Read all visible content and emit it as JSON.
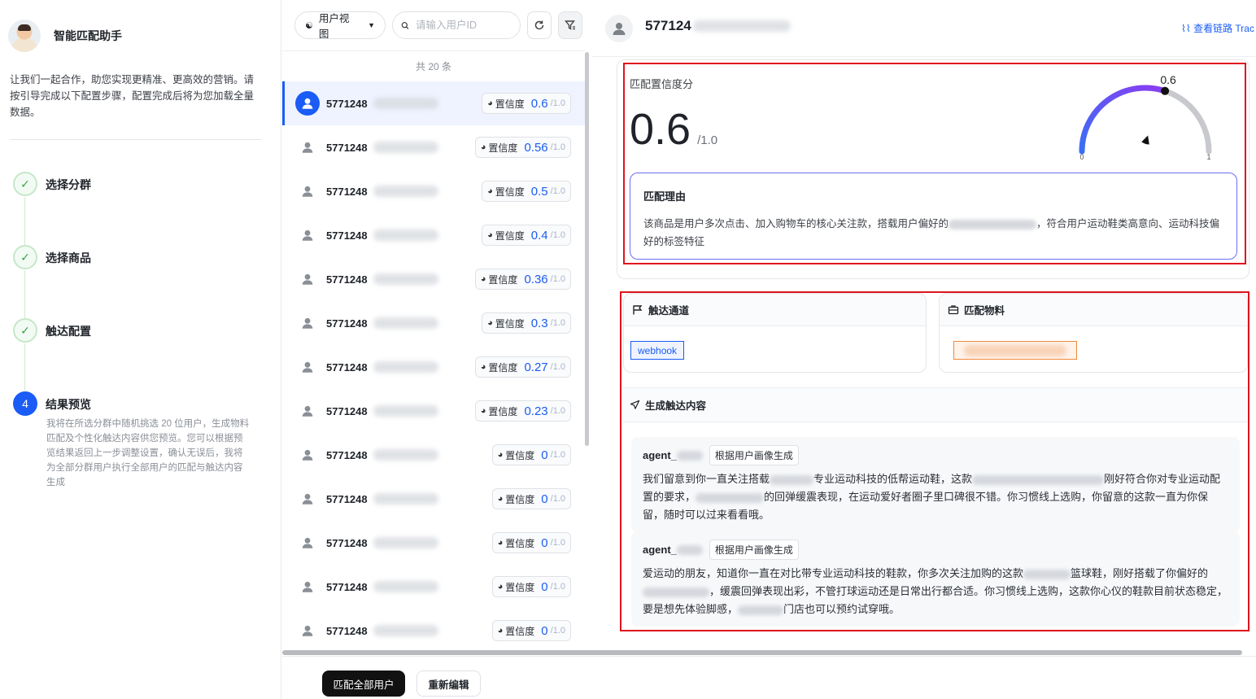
{
  "assistant": {
    "name": "智能匹配助手",
    "intro": "让我们一起合作，助您实现更精准、更高效的营销。请按引导完成以下配置步骤，配置完成后将为您加载全量数据。"
  },
  "steps": [
    {
      "index": "",
      "title": "选择分群",
      "status": "done"
    },
    {
      "index": "",
      "title": "选择商品",
      "status": "done"
    },
    {
      "index": "",
      "title": "触达配置",
      "status": "done"
    },
    {
      "index": "4",
      "title": "结果预览",
      "status": "active",
      "desc": "我将在所选分群中随机挑选 20 位用户，生成物料匹配及个性化触达内容供您预览。您可以根据预览结果返回上一步调整设置，确认无误后，我将为全部分群用户执行全部用户的匹配与触达内容生成"
    }
  ],
  "toolbar": {
    "view_label": "用户视图",
    "search_placeholder": "请输入用户ID"
  },
  "list": {
    "total_label": "共 20 条",
    "score_label": "置信度",
    "score_den": "/1.0",
    "rows": [
      {
        "id": "5771248",
        "score": "0.6"
      },
      {
        "id": "5771248",
        "score": "0.56"
      },
      {
        "id": "5771248",
        "score": "0.5"
      },
      {
        "id": "5771248",
        "score": "0.4"
      },
      {
        "id": "5771248",
        "score": "0.36"
      },
      {
        "id": "5771248",
        "score": "0.3"
      },
      {
        "id": "5771248",
        "score": "0.27"
      },
      {
        "id": "5771248",
        "score": "0.23"
      },
      {
        "id": "5771248",
        "score": "0"
      },
      {
        "id": "5771248",
        "score": "0"
      },
      {
        "id": "5771248",
        "score": "0"
      },
      {
        "id": "5771248",
        "score": "0"
      },
      {
        "id": "5771248",
        "score": "0"
      }
    ]
  },
  "detail": {
    "user_id": "577124",
    "trace_link": "查看链路 Trac",
    "score_title": "匹配置信度分",
    "score": "0.6",
    "score_den": "/1.0",
    "gauge": {
      "value": 0.6,
      "value_label": "0.6",
      "min_label": "0",
      "max_label": "1"
    },
    "reason_title": "匹配理由",
    "reason_text_a": "该商品是用户多次点击、加入购物车的核心关注款，搭载用户偏好的",
    "reason_text_b": "，符合用户运动鞋类高意向、运动科技偏好的标签特征",
    "channel_title": "触达通道",
    "channel_tag": "webhook",
    "material_title": "匹配物料",
    "gen_title": "生成触达内容",
    "messages": [
      {
        "agent": "agent_",
        "badge": "根据用户画像生成",
        "parts": [
          "我们留意到你一直关注搭载",
          "专业运动科技的低帮运动鞋，这款",
          "刚好符合你对专业运动配置的要求，",
          "的回弹缓震表现，在运动爱好者圈子里口碑很不错。你习惯线上选购，你留意的这款一直为你保留，随时可以过来看看哦。"
        ]
      },
      {
        "agent": "agent_",
        "badge": "根据用户画像生成",
        "parts": [
          "爱运动的朋友，知道你一直在对比带专业运动科技的鞋款，你多次关注加购的这款",
          "篮球鞋，刚好搭载了你偏好的",
          "，缓震回弹表现出彩，不管打球运动还是日常出行都合适。你习惯线上选购，这款你心仪的鞋款目前状态稳定，要是想先体验脚感，",
          "门店也可以预约试穿哦。"
        ]
      }
    ]
  },
  "bottom": {
    "match_all": "匹配全部用户",
    "re_edit": "重新编辑"
  },
  "colors": {
    "accent": "#1a5cf5",
    "highlight": "#e0141e",
    "success": "#3da14b"
  }
}
